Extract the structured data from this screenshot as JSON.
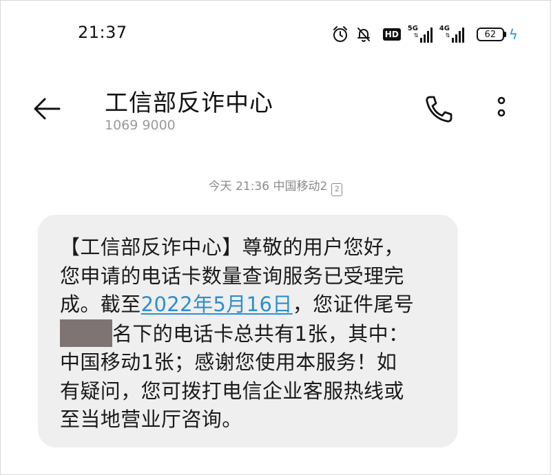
{
  "status_bar": {
    "time": "21:37",
    "hd_label": "HD",
    "sim1_network": "5G",
    "sim2_network": "4G",
    "battery_level": "62",
    "icons": [
      "alarm-icon",
      "mute-bell-icon",
      "hd-voice-icon",
      "signal-5g-icon",
      "signal-4g-icon",
      "battery-icon",
      "charging-bolt-icon"
    ]
  },
  "header": {
    "contact_name": "工信部反诈中心",
    "contact_number": "1069 9000",
    "icons": [
      "back-arrow-icon",
      "phone-icon",
      "more-vertical-icon"
    ]
  },
  "conversation": {
    "timestamp": "今天 21:36",
    "carrier": "中国移动2",
    "sim_badge": "2",
    "message": {
      "line1": "【工信部反诈中心】尊敬的用户您好，",
      "line2": "您申请的电话卡数量查询服务已受理完",
      "line3_prefix": "成。截至",
      "line3_link": "2022年5月16日",
      "line3_suffix": "，您证件尾号",
      "line4_after_redaction": "名下的电话卡总共有1张，其中：",
      "line5": "中国移动1张；感谢您使用本服务！如",
      "line6": "有疑问，您可拨打电信企业客服热线或",
      "line7": "至当地营业厅咨询。"
    }
  },
  "colors": {
    "bubble_bg": "#efefef",
    "link": "#2a8fcf",
    "redaction": "#7e7474",
    "charging": "#1e9be0",
    "secondary_text": "#9a9a9a"
  }
}
